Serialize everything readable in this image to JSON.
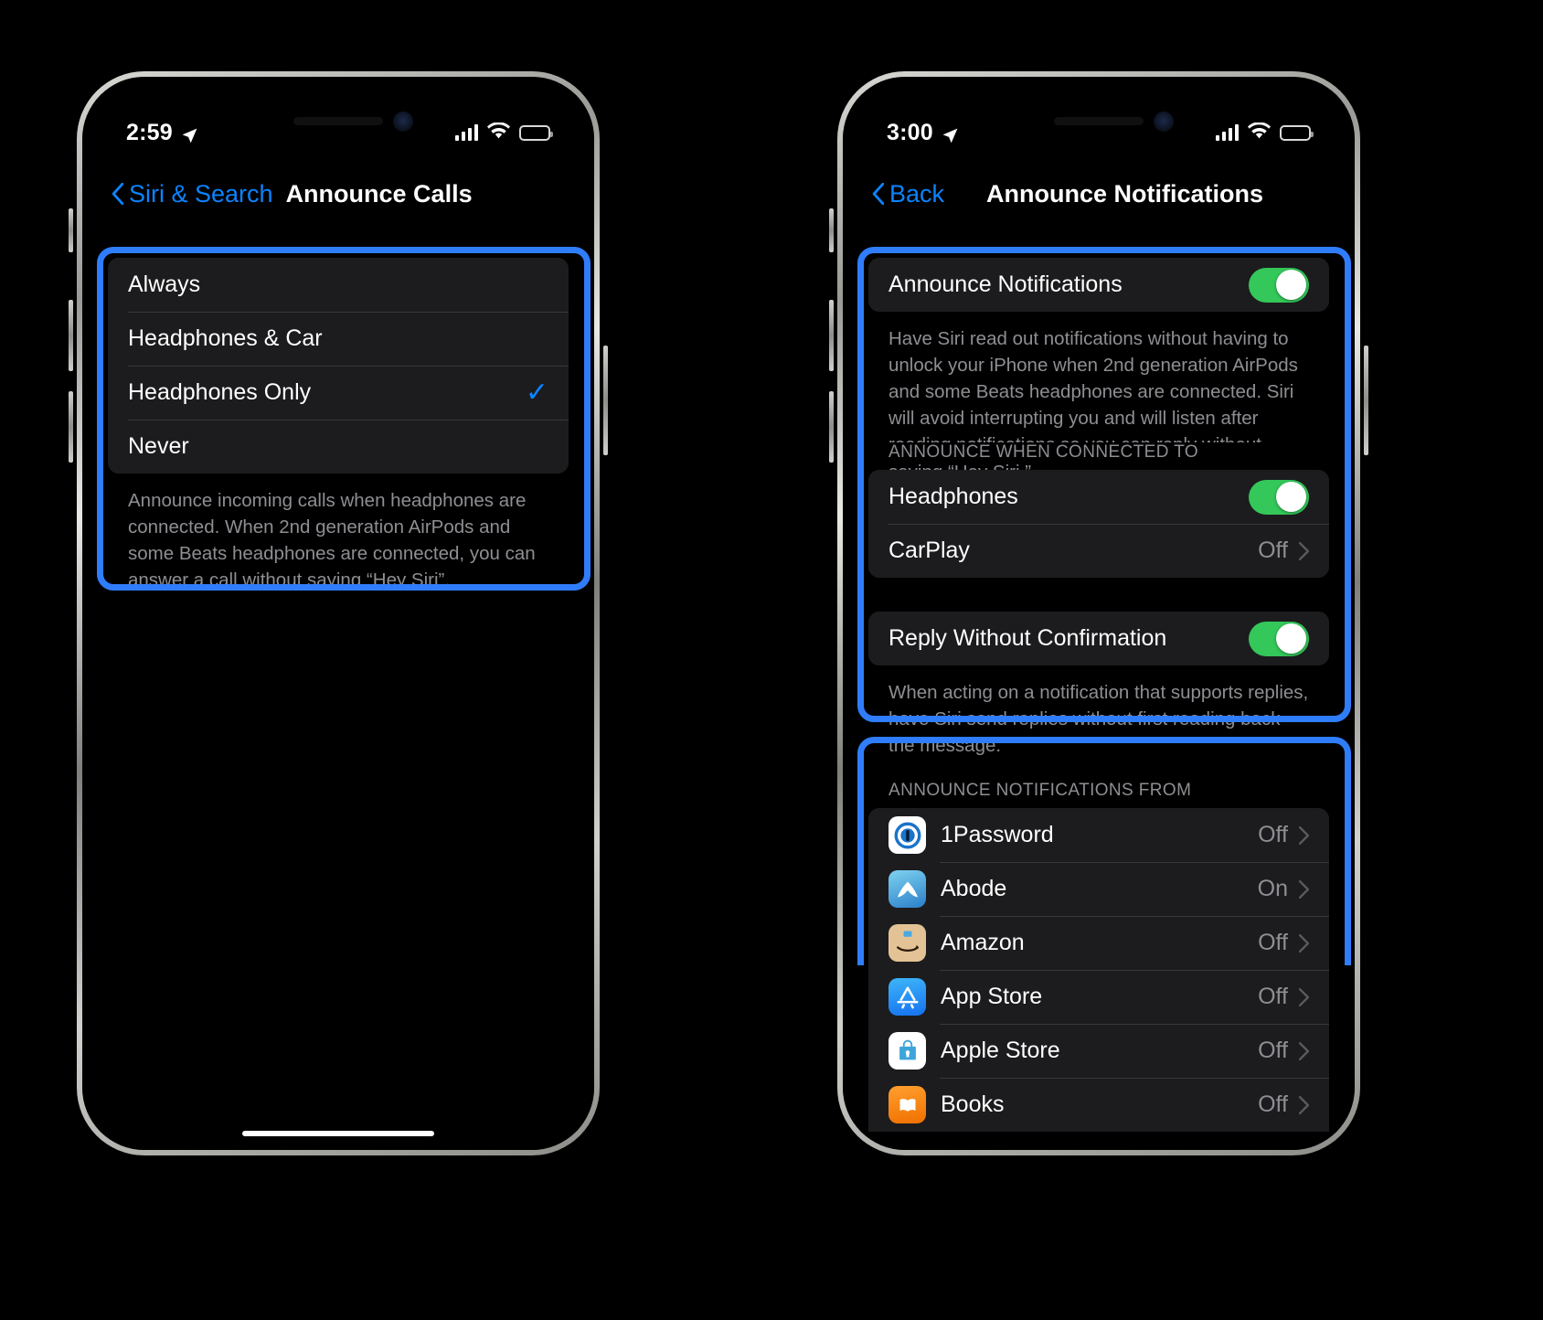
{
  "colors": {
    "highlight": "#2f7dfb",
    "accent_blue": "#0a84ff",
    "toggle_green": "#34c759",
    "group_bg": "#1c1c1e",
    "secondary_text": "#8e8e93"
  },
  "left_phone": {
    "status": {
      "time": "2:59",
      "location_icon": "location-arrow",
      "cellular": "4-bars",
      "wifi": "wifi-full",
      "battery": "battery-full"
    },
    "nav": {
      "back_label": "Siri & Search",
      "title": "Announce Calls"
    },
    "options": [
      {
        "label": "Always",
        "selected": false
      },
      {
        "label": "Headphones & Car",
        "selected": false
      },
      {
        "label": "Headphones Only",
        "selected": true
      },
      {
        "label": "Never",
        "selected": false
      }
    ],
    "checkmark": "✓",
    "footer": "Announce incoming calls when headphones are connected. When 2nd generation AirPods and some Beats headphones are connected, you can answer a call without saying “Hey Siri”."
  },
  "right_phone": {
    "status": {
      "time": "3:00",
      "location_icon": "location-arrow",
      "cellular": "4-bars",
      "wifi": "wifi-full",
      "battery": "battery-full"
    },
    "nav": {
      "back_label": "Back",
      "title": "Announce Notifications"
    },
    "master": {
      "label": "Announce Notifications",
      "toggle": "on"
    },
    "master_footer": "Have Siri read out notifications without having to unlock your iPhone when 2nd generation AirPods and some Beats headphones are connected. Siri will avoid interrupting you and will listen after reading notifications so you can reply without saying “Hey Siri.”",
    "connected_header": "ANNOUNCE WHEN CONNECTED TO",
    "connected_rows": [
      {
        "label": "Headphones",
        "type": "toggle",
        "toggle": "on"
      },
      {
        "label": "CarPlay",
        "type": "value",
        "value": "Off"
      }
    ],
    "reply_row": {
      "label": "Reply Without Confirmation",
      "toggle": "on"
    },
    "reply_footer": "When acting on a notification that supports replies, have Siri send replies without first reading back the message.",
    "apps_header": "ANNOUNCE NOTIFICATIONS FROM",
    "apps": [
      {
        "name": "1Password",
        "icon": "1password-icon",
        "value": "Off"
      },
      {
        "name": "Abode",
        "icon": "abode-icon",
        "value": "On"
      },
      {
        "name": "Amazon",
        "icon": "amazon-icon",
        "value": "Off"
      },
      {
        "name": "App Store",
        "icon": "app-store-icon",
        "value": "Off"
      },
      {
        "name": "Apple Store",
        "icon": "apple-store-icon",
        "value": "Off"
      },
      {
        "name": "Books",
        "icon": "books-icon",
        "value": "Off"
      }
    ]
  }
}
